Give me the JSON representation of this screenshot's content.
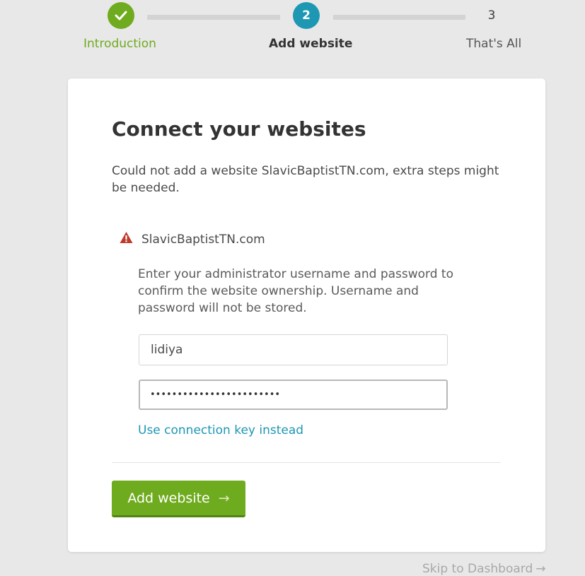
{
  "stepper": {
    "steps": [
      {
        "number": "",
        "label": "Introduction",
        "state": "completed",
        "icon": "check-icon"
      },
      {
        "number": "2",
        "label": "Add website",
        "state": "active"
      },
      {
        "number": "3",
        "label": "That's All",
        "state": "pending"
      }
    ],
    "colors": {
      "completed": "#6fab1e",
      "active": "#1e97b3",
      "connector": "#d3d3d3"
    }
  },
  "card": {
    "title": "Connect your websites",
    "message": "Could not add a website SlavicBaptistTN.com, extra steps might be needed.",
    "site": {
      "name": "SlavicBaptistTN.com",
      "status_icon": "warning-icon",
      "status_color": "#c0392b"
    },
    "instructions": "Enter your administrator username and password to confirm the website ownership. Username and password will not be stored.",
    "username": {
      "value": "lidiya"
    },
    "password": {
      "value": "••••••••••••••••••••••••"
    },
    "alt_link": "Use connection key instead",
    "submit_label": "Add website",
    "submit_icon": "arrow-right-icon"
  },
  "footer": {
    "skip_label": "Skip to Dashboard",
    "skip_icon": "arrow-right-icon"
  }
}
